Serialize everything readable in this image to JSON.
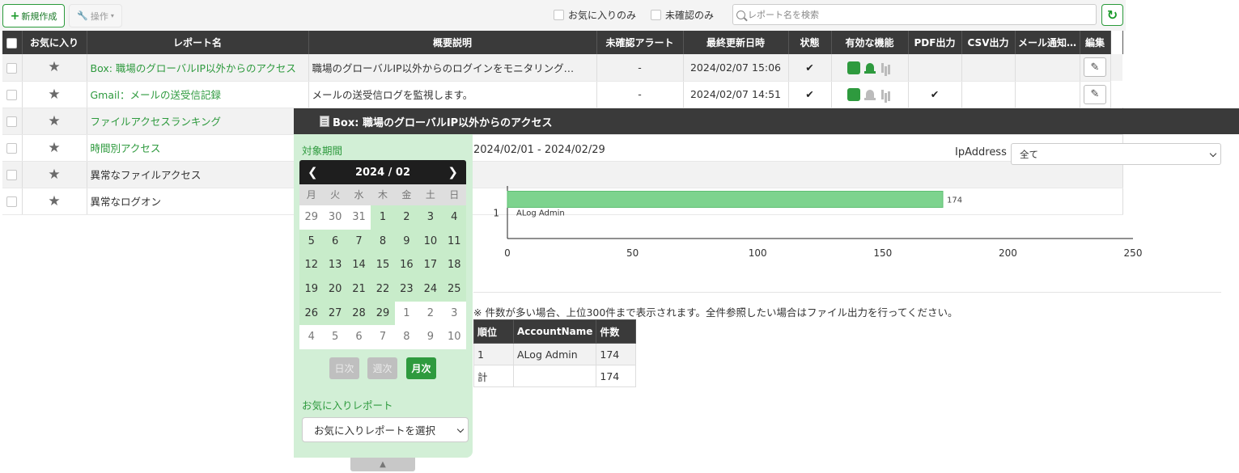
{
  "toolbar": {
    "new_label": "新規作成",
    "ops_label": "操作",
    "fav_only_label": "お気に入りのみ",
    "unconfirmed_only_label": "未確認のみ",
    "search_placeholder": "レポート名を検索"
  },
  "reports": {
    "headers": [
      "お気に入り",
      "レポート名",
      "概要説明",
      "未確認アラート",
      "最終更新日時",
      "状態",
      "有効な機能",
      "PDF出力",
      "CSV出力",
      "メール通知…",
      "編集"
    ],
    "rows": [
      {
        "name": "Box: 職場のグローバルIP以外からのアクセス",
        "description": "職場のグローバルIP以外からのログインをモニタリング…",
        "alert": "-",
        "updated": "2024/02/07 15:06",
        "status": "✔",
        "pdf": ""
      },
      {
        "name": "Gmail：メールの送受信記録",
        "description": "メールの送受信ログを監視します。",
        "alert": "-",
        "updated": "2024/02/07 14:51",
        "status": "✔",
        "pdf": "✔"
      },
      {
        "name": "ファイルアクセスランキング"
      },
      {
        "name": "時間別アクセス"
      },
      {
        "name": "異常なファイルアクセス"
      },
      {
        "name": "異常なログオン"
      }
    ]
  },
  "dialog": {
    "title": "Box: 職場のグローバルIP以外からのアクセス",
    "period_label": "対象期間",
    "period_range": "2024/02/01 - 2024/02/29",
    "calendar": {
      "month": "2024 / 02",
      "weekdays": [
        "月",
        "火",
        "水",
        "木",
        "金",
        "土",
        "日"
      ],
      "weeks": [
        [
          "29",
          "30",
          "31",
          "1",
          "2",
          "3",
          "4"
        ],
        [
          "5",
          "6",
          "7",
          "8",
          "9",
          "10",
          "11"
        ],
        [
          "12",
          "13",
          "14",
          "15",
          "16",
          "17",
          "18"
        ],
        [
          "19",
          "20",
          "21",
          "22",
          "23",
          "24",
          "25"
        ],
        [
          "26",
          "27",
          "28",
          "29",
          "1",
          "2",
          "3"
        ],
        [
          "4",
          "5",
          "6",
          "7",
          "8",
          "9",
          "10"
        ]
      ]
    },
    "granularity": {
      "daily": "日次",
      "weekly": "週次",
      "monthly": "月次"
    },
    "fav_report_label": "お気に入りレポート",
    "fav_report_placeholder": "お気に入りレポートを選択",
    "ip_label": "IpAddress",
    "ip_value": "全て",
    "note": "※ 件数が多い場合、上位300件まで表示されます。全件参照したい場合はファイル出力を行ってください。",
    "table": {
      "headers": [
        "順位",
        "AccountName",
        "件数"
      ],
      "rows": [
        [
          "1",
          "ALog Admin",
          "174"
        ],
        [
          "計",
          "",
          "174"
        ]
      ]
    }
  },
  "chart_data": {
    "type": "bar",
    "orientation": "horizontal",
    "categories": [
      "1"
    ],
    "bar_labels": [
      "ALog Admin"
    ],
    "values": [
      174
    ],
    "xlim": [
      0,
      250
    ],
    "xticks": [
      0,
      50,
      100,
      150,
      200,
      250
    ],
    "color": "#7dd38e"
  },
  "colors": {
    "accent": "#2e9a3e",
    "header_bg": "#3a3a3a",
    "side_bg": "#d2efd6"
  }
}
